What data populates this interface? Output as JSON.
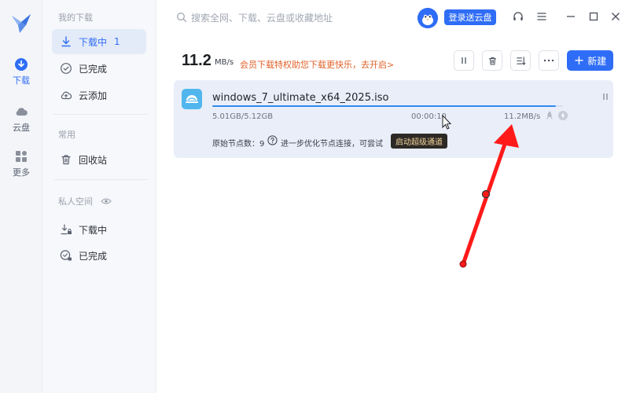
{
  "rail": {
    "items": [
      {
        "label": "下载",
        "icon": "download-circle-icon",
        "active": true
      },
      {
        "label": "云盘",
        "icon": "cloud-icon",
        "active": false
      },
      {
        "label": "更多",
        "icon": "apps-icon",
        "active": false
      }
    ]
  },
  "sidebar": {
    "my_downloads_heading": "我的下载",
    "downloading_label": "下载中",
    "downloading_count": "1",
    "completed_label": "已完成",
    "cloud_add_label": "云添加",
    "common_heading": "常用",
    "recycle_label": "回收站",
    "private_heading": "私人空间",
    "private_downloading_label": "下载中",
    "private_completed_label": "已完成"
  },
  "topbar": {
    "search_placeholder": "搜索全网、下载、云盘或收藏地址",
    "login_button": "登录送云盘"
  },
  "header": {
    "speed_value": "11.2",
    "speed_unit": "MB/s",
    "vip_promo": "会员下载特权助您下载更快乐，去开启>",
    "new_button": "新建"
  },
  "task": {
    "file_name": "windows_7_ultimate_x64_2025.iso",
    "size_progress": "5.01GB/5.12GB",
    "elapsed": "00:00:10",
    "rate": "11.2MB/s",
    "progress": 0.979,
    "source_nodes": "原始节点数：9",
    "optimize_hint": "进一步优化节点连接，可尝试",
    "boost_button": "启动超级通道"
  },
  "colors": {
    "accent": "#2f6df6",
    "promo": "#e0622a",
    "progress": "#2f8bf0",
    "card_bg": "#e9eef9",
    "annotation_arrow": "#ff1a1a"
  }
}
